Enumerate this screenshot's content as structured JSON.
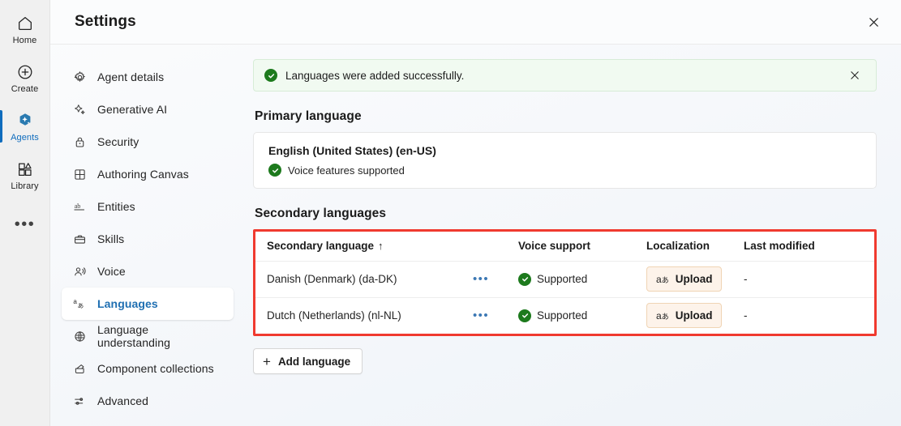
{
  "rail": {
    "items": [
      {
        "label": "Home",
        "icon": "home-icon",
        "active": false
      },
      {
        "label": "Create",
        "icon": "plus-circle-icon",
        "active": false
      },
      {
        "label": "Agents",
        "icon": "agents-sparkle-icon",
        "active": true
      },
      {
        "label": "Library",
        "icon": "library-icon",
        "active": false
      }
    ],
    "more_label": "•••"
  },
  "header": {
    "title": "Settings",
    "close_label": "Close"
  },
  "nav": {
    "items": [
      {
        "label": "Agent details",
        "icon": "gear-icon",
        "selected": false
      },
      {
        "label": "Generative AI",
        "icon": "sparkle-icon",
        "selected": false
      },
      {
        "label": "Security",
        "icon": "lock-icon",
        "selected": false
      },
      {
        "label": "Authoring Canvas",
        "icon": "grid-icon",
        "selected": false
      },
      {
        "label": "Entities",
        "icon": "ab-text-icon",
        "selected": false
      },
      {
        "label": "Skills",
        "icon": "briefcase-icon",
        "selected": false
      },
      {
        "label": "Voice",
        "icon": "voice-person-icon",
        "selected": false
      },
      {
        "label": "Languages",
        "icon": "language-glyph-icon",
        "selected": true
      },
      {
        "label": "Language understanding",
        "icon": "globe-brain-icon",
        "selected": false
      },
      {
        "label": "Component collections",
        "icon": "collections-icon",
        "selected": false
      },
      {
        "label": "Advanced",
        "icon": "sliders-icon",
        "selected": false
      }
    ]
  },
  "banner": {
    "message": "Languages were added successfully.",
    "icon": "success-check-icon",
    "close_icon": "close-icon",
    "bg_color": "#f1faf1",
    "border_color": "#d7ecd7",
    "accent_color": "#1d7a1d"
  },
  "primary": {
    "section_title": "Primary language",
    "language": "English (United States) (en-US)",
    "voice_status": "Voice features supported",
    "status_icon": "success-check-icon"
  },
  "secondary": {
    "section_title": "Secondary languages",
    "highlight_color": "#f03a2f",
    "columns": [
      {
        "label": "Secondary language",
        "sort": "↑"
      },
      {
        "label": "Voice support"
      },
      {
        "label": "Localization"
      },
      {
        "label": "Last modified"
      }
    ],
    "rows": [
      {
        "language": "Danish (Denmark) (da-DK)",
        "overflow": "•••",
        "voice_support": "Supported",
        "voice_icon": "success-check-icon",
        "localization_button": "Upload",
        "localization_icon": "language-glyph-icon",
        "last_modified": "-"
      },
      {
        "language": "Dutch (Netherlands) (nl-NL)",
        "overflow": "•••",
        "voice_support": "Supported",
        "voice_icon": "success-check-icon",
        "localization_button": "Upload",
        "localization_icon": "language-glyph-icon",
        "last_modified": "-"
      }
    ],
    "add_button": "Add language",
    "add_icon": "plus-icon"
  }
}
